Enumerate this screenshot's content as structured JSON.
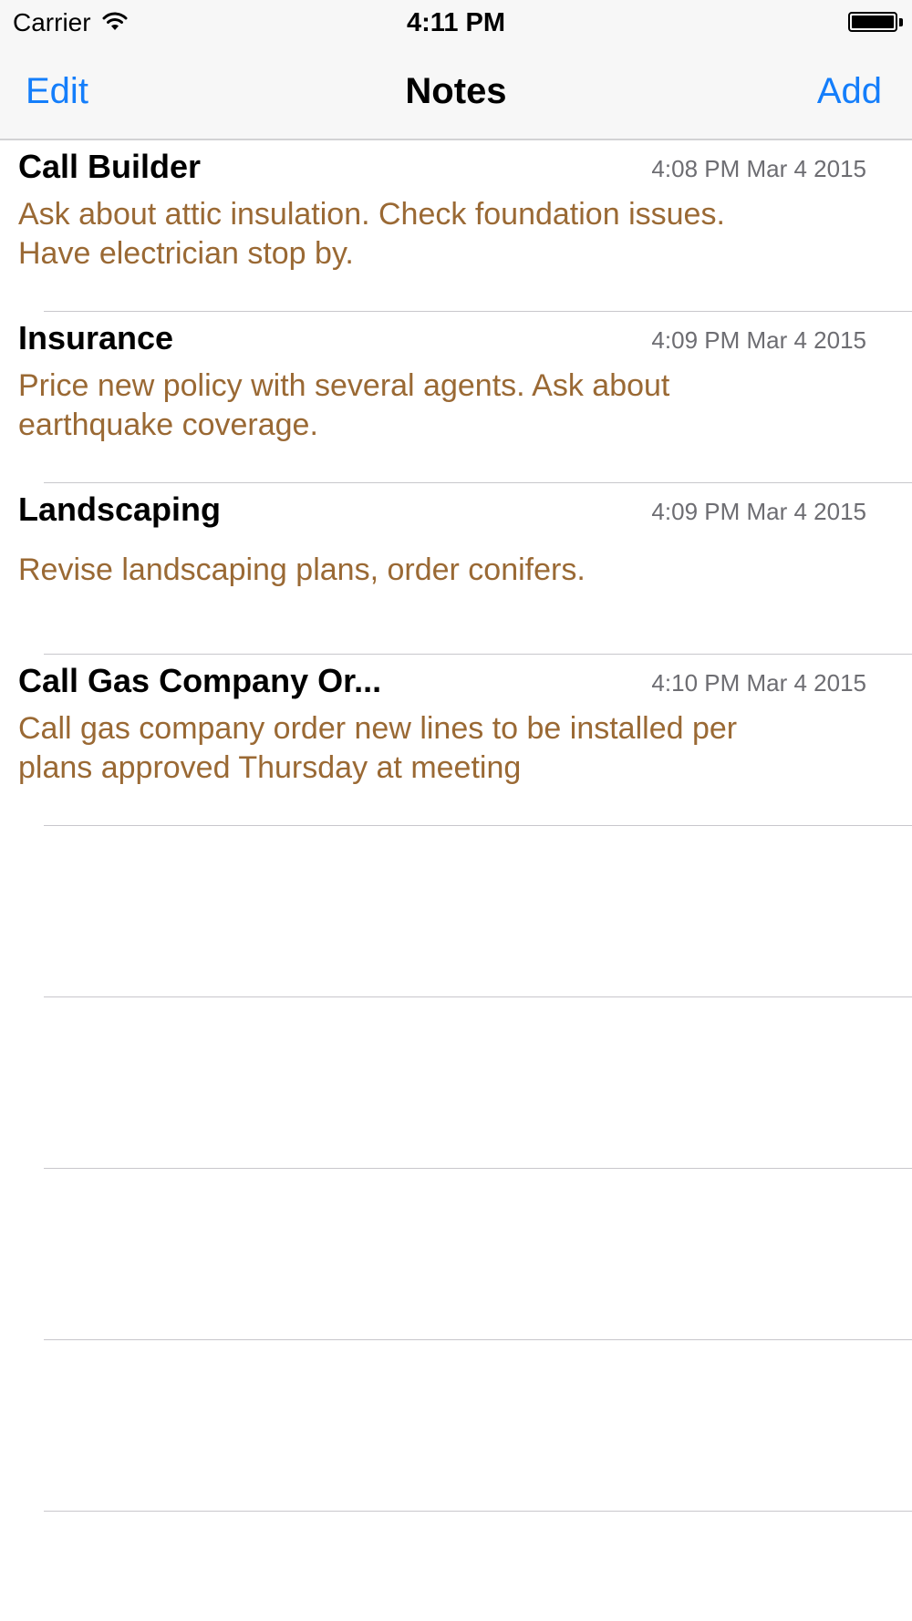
{
  "status_bar": {
    "carrier": "Carrier",
    "time": "4:11 PM"
  },
  "nav": {
    "left_button": "Edit",
    "title": "Notes",
    "right_button": "Add",
    "accent_color": "#147efb"
  },
  "notes": [
    {
      "title": "Call Builder",
      "date": "4:08 PM Mar 4 2015",
      "body_lines": [
        "Ask about attic insulation. Check foundation issues.",
        "Have electrician stop by."
      ]
    },
    {
      "title": "Insurance",
      "date": "4:09 PM Mar 4 2015",
      "body_lines": [
        "Price new policy with several agents. Ask about",
        "earthquake coverage."
      ]
    },
    {
      "title": "Landscaping",
      "date": "4:09 PM Mar 4 2015",
      "body_lines": [
        "Revise landscaping plans, order conifers."
      ]
    },
    {
      "title": "Call Gas Company Or...",
      "date": "4:10 PM Mar 4 2015",
      "body_lines": [
        "Call gas company order new lines to be installed per",
        "plans approved Thursday at meeting"
      ]
    }
  ],
  "colors": {
    "note_body": "#9a6934",
    "date_text": "#6d6d72",
    "separator": "#c8c7cc",
    "bar_background": "#f7f7f7"
  }
}
